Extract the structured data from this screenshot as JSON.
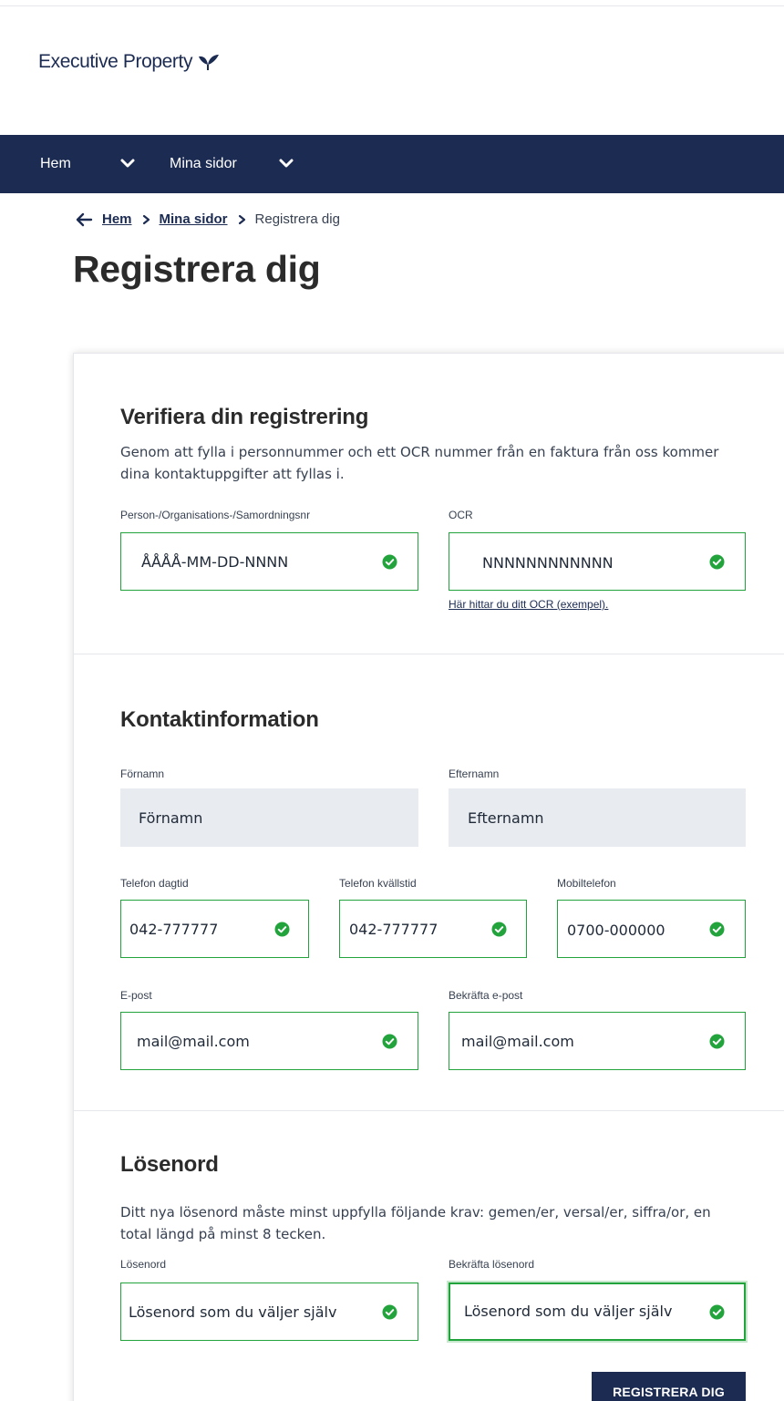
{
  "brand": {
    "name": "Executive Property",
    "icon": "bird-leaf-logo-icon",
    "color": "#1c2b52"
  },
  "nav": {
    "items": [
      {
        "label": "Hem",
        "icon": "chevron-down-icon"
      },
      {
        "label": "Mina sidor",
        "icon": "chevron-down-icon"
      }
    ]
  },
  "breadcrumb": {
    "back_icon": "arrow-left-icon",
    "items": [
      {
        "label": "Hem"
      },
      {
        "label": "Mina sidor"
      }
    ],
    "current": "Registrera dig"
  },
  "page": {
    "title": "Registrera dig"
  },
  "verify": {
    "title": "Verifiera din registrering",
    "description": "Genom att fylla i personnummer och ett OCR nummer från en faktura från oss kommer dina kontaktuppgifter att fyllas i.",
    "fields": {
      "personnr": {
        "label": "Person-/Organisations-/Samordningsnr",
        "value": "ÅÅÅÅ-MM-DD-NNNN",
        "status": "valid"
      },
      "ocr": {
        "label": "OCR",
        "value": "NNNNNNNNNNNN",
        "status": "valid"
      }
    },
    "ocr_help_link": "Här hittar du ditt OCR (exempel)."
  },
  "contact": {
    "title": "Kontaktinformation",
    "fields": {
      "firstname": {
        "label": "Förnamn",
        "value": "Förnamn",
        "disabled": true
      },
      "lastname": {
        "label": "Efternamn",
        "value": "Efternamn",
        "disabled": true
      },
      "phone_day": {
        "label": "Telefon dagtid",
        "value": "042-777777",
        "status": "valid"
      },
      "phone_evening": {
        "label": "Telefon kvällstid",
        "value": "042-777777",
        "status": "valid"
      },
      "mobile": {
        "label": "Mobiltelefon",
        "value": "0700-000000",
        "status": "valid"
      },
      "email": {
        "label": "E-post",
        "value": "mail@mail.com",
        "status": "valid"
      },
      "email_confirm": {
        "label": "Bekräfta e-post",
        "value": "mail@mail.com",
        "status": "valid"
      }
    }
  },
  "password": {
    "title": "Lösenord",
    "description": "Ditt nya lösenord måste minst uppfylla följande krav: gemen/er, versal/er, siffra/or, en total längd på minst 8 tecken.",
    "fields": {
      "password": {
        "label": "Lösenord",
        "value": "Lösenord som du väljer själv",
        "status": "valid"
      },
      "password_confirm": {
        "label": "Bekräfta lösenord",
        "value": "Lösenord som du väljer själv",
        "status": "valid",
        "focused": true
      }
    }
  },
  "submit": {
    "label": "REGISTRERA DIG"
  },
  "colors": {
    "navy": "#1c2b52",
    "valid_green": "#22a33b",
    "disabled_bg": "#e8ebef"
  }
}
